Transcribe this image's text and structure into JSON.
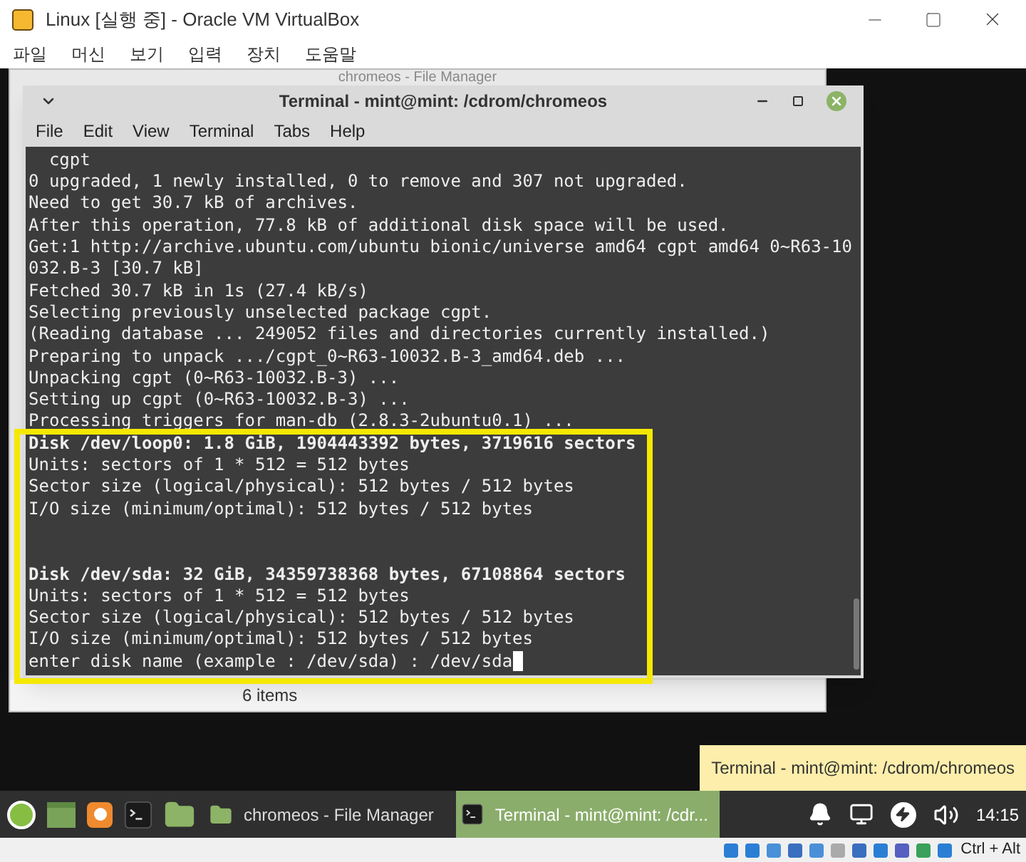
{
  "host_window": {
    "title": "Linux [실행 중] - Oracle VM VirtualBox",
    "menu": [
      "파일",
      "머신",
      "보기",
      "입력",
      "장치",
      "도움말"
    ]
  },
  "file_manager": {
    "title": "chromeos - File Manager",
    "status": "6 items"
  },
  "terminal": {
    "title": "Terminal - mint@mint: /cdrom/chromeos",
    "menu": [
      "File",
      "Edit",
      "View",
      "Terminal",
      "Tabs",
      "Help"
    ],
    "lines": [
      {
        "kind": "normal",
        "text": "  cgpt"
      },
      {
        "kind": "normal",
        "text": "0 upgraded, 1 newly installed, 0 to remove and 307 not upgraded."
      },
      {
        "kind": "normal",
        "text": "Need to get 30.7 kB of archives."
      },
      {
        "kind": "normal",
        "text": "After this operation, 77.8 kB of additional disk space will be used."
      },
      {
        "kind": "normal",
        "text": "Get:1 http://archive.ubuntu.com/ubuntu bionic/universe amd64 cgpt amd64 0~R63-10"
      },
      {
        "kind": "normal",
        "text": "032.B-3 [30.7 kB]"
      },
      {
        "kind": "normal",
        "text": "Fetched 30.7 kB in 1s (27.4 kB/s)"
      },
      {
        "kind": "normal",
        "text": "Selecting previously unselected package cgpt."
      },
      {
        "kind": "normal",
        "text": "(Reading database ... 249052 files and directories currently installed.)"
      },
      {
        "kind": "normal",
        "text": "Preparing to unpack .../cgpt_0~R63-10032.B-3_amd64.deb ..."
      },
      {
        "kind": "normal",
        "text": "Unpacking cgpt (0~R63-10032.B-3) ..."
      },
      {
        "kind": "normal",
        "text": "Setting up cgpt (0~R63-10032.B-3) ..."
      },
      {
        "kind": "normal",
        "text": "Processing triggers for man-db (2.8.3-2ubuntu0.1) ..."
      },
      {
        "kind": "bold",
        "text": "Disk /dev/loop0: 1.8 GiB, 1904443392 bytes, 3719616 sectors"
      },
      {
        "kind": "normal",
        "text": "Units: sectors of 1 * 512 = 512 bytes"
      },
      {
        "kind": "normal",
        "text": "Sector size (logical/physical): 512 bytes / 512 bytes"
      },
      {
        "kind": "normal",
        "text": "I/O size (minimum/optimal): 512 bytes / 512 bytes"
      },
      {
        "kind": "blank"
      },
      {
        "kind": "blank"
      },
      {
        "kind": "bold",
        "text": "Disk /dev/sda: 32 GiB, 34359738368 bytes, 67108864 sectors"
      },
      {
        "kind": "normal",
        "text": "Units: sectors of 1 * 512 = 512 bytes"
      },
      {
        "kind": "normal",
        "text": "Sector size (logical/physical): 512 bytes / 512 bytes"
      },
      {
        "kind": "normal",
        "text": "I/O size (minimum/optimal): 512 bytes / 512 bytes"
      },
      {
        "kind": "prompt",
        "text": "enter disk name (example : /dev/sda) : /dev/sda"
      }
    ]
  },
  "tooltip": "Terminal - mint@mint: /cdrom/chromeos",
  "taskbar": {
    "windows": [
      {
        "kind": "folder",
        "label": "chromeos - File Manager",
        "selected": false
      },
      {
        "kind": "terminal",
        "label": "Terminal - mint@mint: /cdr...",
        "selected": true
      }
    ],
    "clock": "14:15"
  },
  "vbox_status": {
    "hostkey": "Ctrl + Alt"
  }
}
